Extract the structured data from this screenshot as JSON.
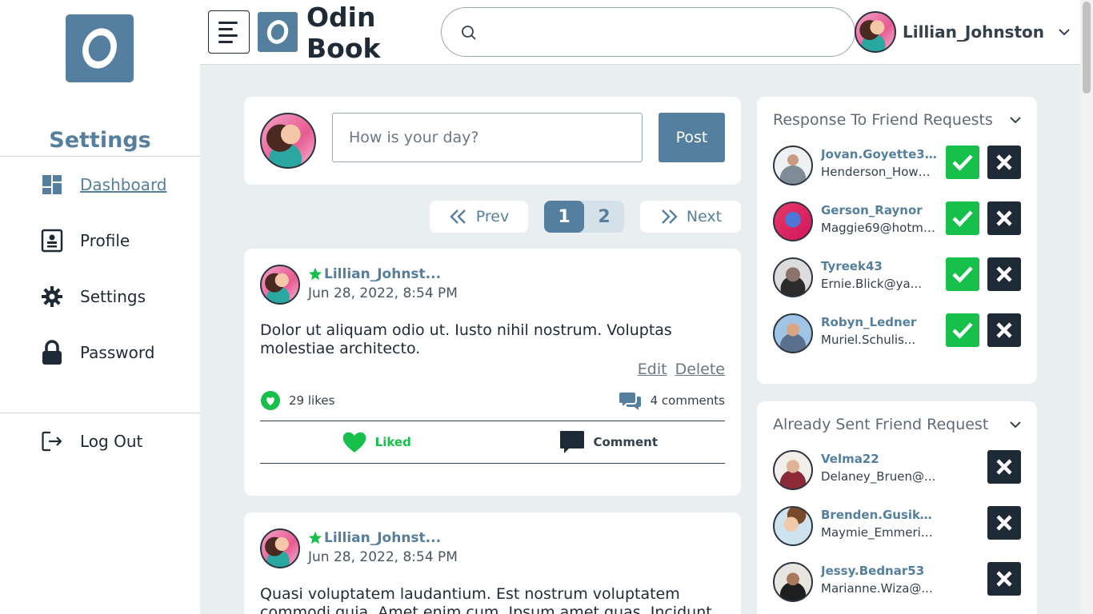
{
  "sidebar": {
    "title": "Settings",
    "items": [
      {
        "label": "Dashboard"
      },
      {
        "label": "Profile"
      },
      {
        "label": "Settings"
      },
      {
        "label": "Password"
      }
    ],
    "logout_label": "Log Out"
  },
  "header": {
    "brand_line1": "Odin",
    "brand_line2": "Book",
    "search_placeholder": "",
    "user_name": "Lillian_Johnston"
  },
  "composer": {
    "placeholder": "How is your day?",
    "post_label": "Post"
  },
  "pagination": {
    "prev_label": "Prev",
    "next_label": "Next",
    "pages": [
      "1",
      "2"
    ],
    "current_page": "1"
  },
  "posts": [
    {
      "author": "Lillian_Johnst...",
      "date": "Jun 28, 2022, 8:54 PM",
      "body": "Dolor ut aliquam odio ut. Iusto nihil nostrum. Voluptas molestiae architecto.",
      "edit_label": "Edit",
      "delete_label": "Delete",
      "likes": "29 likes",
      "comments": "4 comments",
      "like_action": "Liked",
      "comment_action": "Comment"
    },
    {
      "author": "Lillian_Johnst...",
      "date": "Jun 28, 2022, 8:54 PM",
      "body": "Quasi voluptatem laudantium. Est nostrum voluptatem commodi quia. Amet enim cum. Ipsum amet quas. Incidunt"
    }
  ],
  "friend_requests": {
    "title": "Response To Friend Requests",
    "items": [
      {
        "name": "Jovan.Goyette3...",
        "email": "Henderson_Howe..."
      },
      {
        "name": "Gerson_Raynor",
        "email": "Maggie69@hotma..."
      },
      {
        "name": "Tyreek43",
        "email": "Ernie.Blick@ya..."
      },
      {
        "name": "Robyn_Ledner",
        "email": "Muriel.Schulis..."
      }
    ]
  },
  "sent_requests": {
    "title": "Already Sent Friend Request",
    "items": [
      {
        "name": "Velma22",
        "email": "Delaney_Bruen@..."
      },
      {
        "name": "Brenden.Gusiko...",
        "email": "Maymie_Emmeric..."
      },
      {
        "name": "Jessy.Bednar53",
        "email": "Marianne.Wiza@..."
      }
    ]
  },
  "colors": {
    "accent": "#557f9e",
    "accept": "#16c04a",
    "reject": "#1f2a37",
    "liked": "#16c04a",
    "background": "#e9eef1"
  },
  "icons": [
    "logo-icon",
    "dashboard-icon",
    "profile-icon",
    "settings-gear-icon",
    "lock-icon",
    "logout-icon",
    "hamburger-menu-icon",
    "search-icon",
    "chevron-down-icon",
    "double-chevron-left-icon",
    "double-chevron-right-icon",
    "star-icon",
    "heart-icon",
    "comments-icon",
    "comment-icon",
    "check-icon",
    "x-icon"
  ]
}
